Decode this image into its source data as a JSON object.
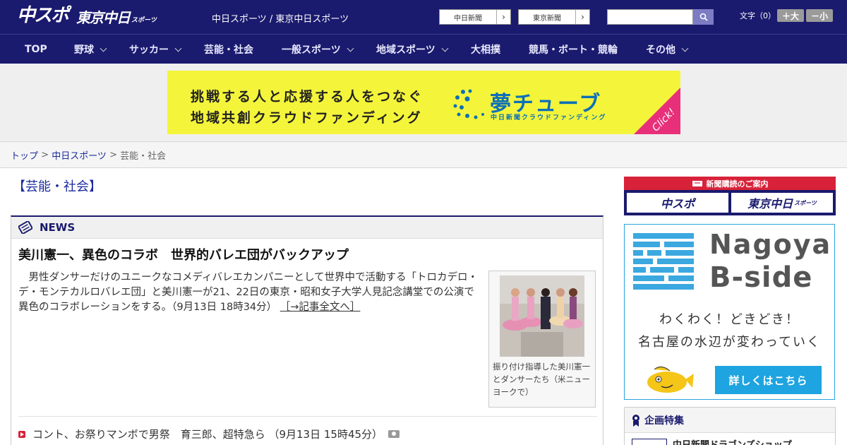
{
  "header": {
    "logo_main": "中スポ",
    "logo_tokyo": "東京中日",
    "logo_sports": "スポーツ",
    "site_title": "中日スポーツ / 東京中日スポーツ",
    "btn_chunichi": "中日新聞",
    "btn_tokyo": "東京新聞",
    "arrow": "›",
    "search_placeholder": "",
    "font_label": "文字（0）",
    "font_up": "＋大",
    "font_down": "－小"
  },
  "nav": {
    "items": [
      {
        "label": "TOP"
      },
      {
        "label": "野球"
      },
      {
        "label": "サッカー"
      },
      {
        "label": "芸能・社会"
      },
      {
        "label": "一般スポーツ"
      },
      {
        "label": "地域スポーツ"
      },
      {
        "label": "大相撲"
      },
      {
        "label": "競馬・ボート・競輪"
      },
      {
        "label": "その他"
      }
    ]
  },
  "banner": {
    "line1": "挑戦する人と応援する人をつなぐ",
    "line2": "地域共創クラウドファンディング",
    "brand": "夢チューブ",
    "brand_sub": "中日新聞クラウドファンディング",
    "click": "Click!",
    "accent_color": "#f4f53a"
  },
  "breadcrumb": {
    "home": "トップ",
    "sep": " > ",
    "parent": "中日スポーツ",
    "current": "芸能・社会"
  },
  "section": {
    "title": "【芸能・社会】"
  },
  "news": {
    "label": "NEWS",
    "headline": "美川憲一、異色のコラボ　世界的バレエ団がバックアップ",
    "lead": "　男性ダンサーだけのユニークなコメディバレエカンパニーとして世界中で活動する「トロカデロ・デ・モンテカルロバレエ団」と美川憲一が21、22日の東京・昭和女子大学人見記念講堂での公演で異色のコラボレーションをする。（9月13日 18時34分）",
    "lead_link": "［→記事全文へ］",
    "caption": "振り付け指導した美川憲一とダンサーたち（米ニューヨークで）",
    "sub_item": "コント、お祭りマンボで男祭　育三郎、超特急ら （9月13日 15時45分）"
  },
  "sidebar": {
    "subscribe_title": "新聞購読のご案内",
    "sub_logo1": "中スポ",
    "sub_logo2": "東京中日",
    "sub_logo2_suffix": "スポーツ",
    "bside_t1": "Nagoya",
    "bside_t2": "B-side",
    "bside_w1": "わくわく！どきどき！",
    "bside_w2": "名古屋の水辺が変わっていく",
    "bside_cta": "詳しくはこちら",
    "feature_title": "企画特集",
    "feature_item": "中日新聞ドラゴンズショップ"
  }
}
